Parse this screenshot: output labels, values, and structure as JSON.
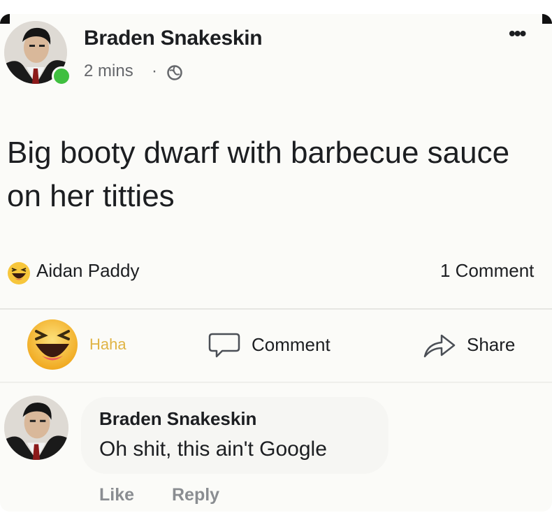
{
  "post": {
    "author": "Braden Snakeskin",
    "time": "2 mins",
    "separator": "·",
    "text": "Big booty dwarf with barbecue sauce on her titties",
    "more_glyph": "•••",
    "privacy_icon": "globe-icon"
  },
  "reactions": {
    "icon": "haha-reaction-icon",
    "reactor": "Aidan Paddy",
    "comment_count": "1 Comment"
  },
  "actions": {
    "haha": "Haha",
    "comment": "Comment",
    "share": "Share"
  },
  "comment": {
    "author": "Braden Snakeskin",
    "text": "Oh shit, this ain't Google",
    "like": "Like",
    "reply": "Reply"
  },
  "colors": {
    "online": "#3fbf3f",
    "haha_label": "#e0b445",
    "muted": "#8a8d91"
  }
}
